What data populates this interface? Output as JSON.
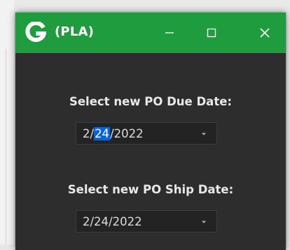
{
  "window": {
    "title": "(PLA)",
    "logo_letter": "G",
    "colors": {
      "titlebar": "#1f9c3d",
      "background": "#2d2d2d",
      "selection": "#0a64d8"
    },
    "controls": {
      "minimize_icon": "minimize-icon",
      "maximize_icon": "maximize-icon",
      "close_icon": "close-icon"
    }
  },
  "due_date": {
    "label": "Select new PO Due Date:",
    "month": "2",
    "sep1": "/",
    "day": "24",
    "sep2": "/",
    "year": "2022",
    "selected_segment": "day"
  },
  "ship_date": {
    "label": "Select new PO Ship Date:",
    "value": "2/24/2022"
  }
}
